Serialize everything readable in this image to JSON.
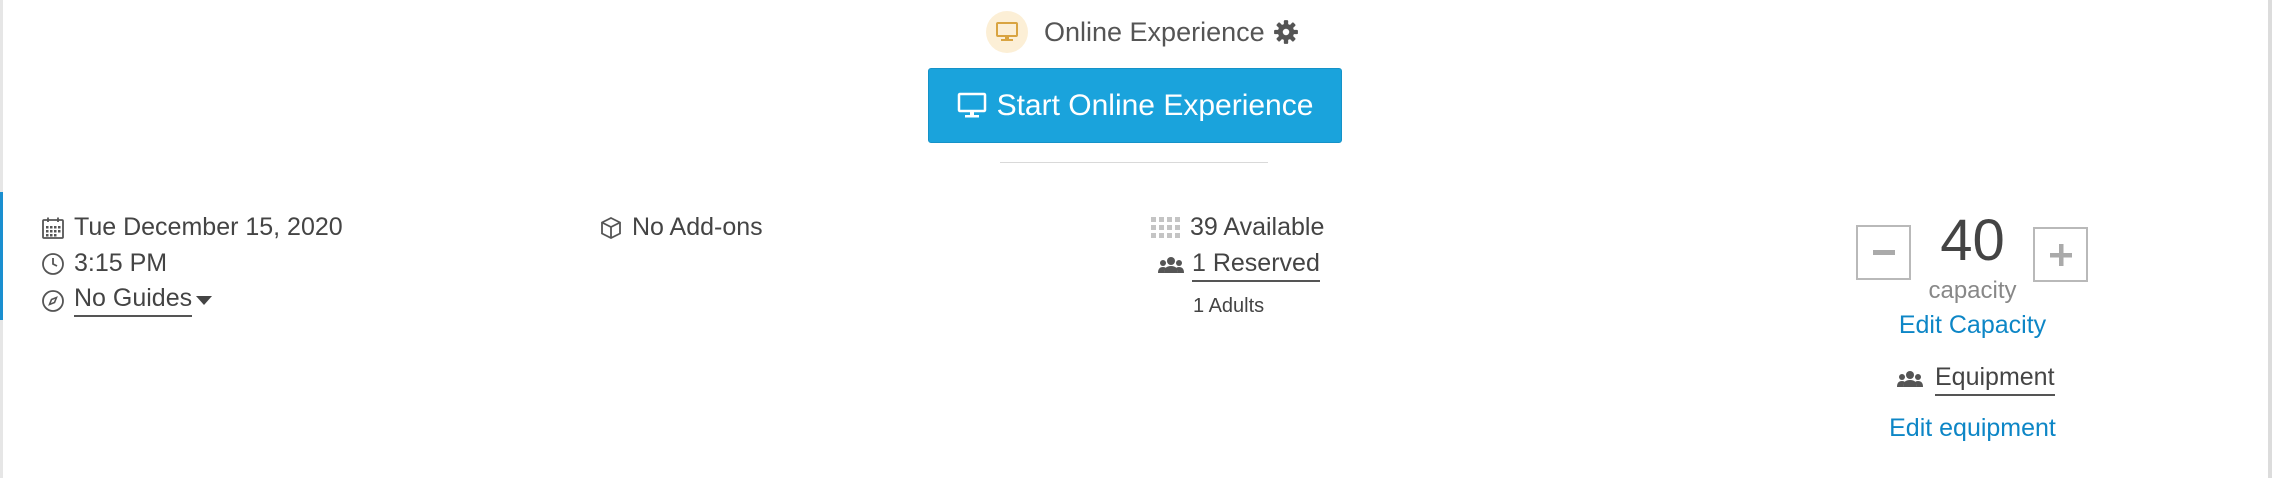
{
  "header": {
    "title": "Online Experience",
    "start_button_label": "Start Online Experience"
  },
  "booking": {
    "date": "Tue December 15, 2020",
    "time": "3:15 PM",
    "guides": "No Guides",
    "addons": "No Add-ons"
  },
  "availability": {
    "available": "39 Available",
    "reserved": "1 Reserved",
    "breakdown": "1 Adults"
  },
  "capacity": {
    "value": "40",
    "label": "capacity",
    "edit_capacity": "Edit Capacity",
    "equipment": "Equipment",
    "edit_equipment": "Edit equipment"
  },
  "colors": {
    "accent": "#1aa3dc",
    "link": "#0d86c6",
    "badge_bg": "#fcefd6",
    "badge_icon": "#d9a441"
  }
}
